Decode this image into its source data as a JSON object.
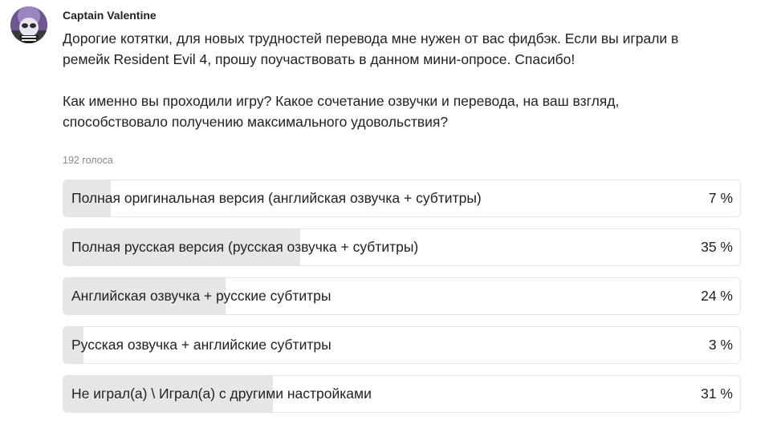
{
  "post": {
    "author": "Captain Valentine",
    "avatar_icon": "avatar-image",
    "paragraphs": [
      "Дорогие котятки, для новых трудностей перевода мне нужен от вас фидбэк. Если вы играли в\nремейк Resident Evil 4, прошу поучаствовать в данном мини-опросе. Спасибо!",
      "Как именно вы проходили игру? Какое сочетание озвучки и перевода, на ваш взгляд,\nспособствовало получению максимального удовольствия?"
    ]
  },
  "poll": {
    "votes_label": "192 голоса",
    "fill_color": "#e6e6e6",
    "options": [
      {
        "label": "Полная оригинальная версия (английская озвучка + субтитры)",
        "percent_label": "7 %",
        "fill_fraction": 0.07
      },
      {
        "label": "Полная русская версия (русская озвучка + субтитры)",
        "percent_label": "35 %",
        "fill_fraction": 0.35
      },
      {
        "label": "Английская озвучка + русские субтитры",
        "percent_label": "24 %",
        "fill_fraction": 0.24
      },
      {
        "label": "Русская озвучка + английские субтитры",
        "percent_label": "3 %",
        "fill_fraction": 0.03
      },
      {
        "label": "Не играл(а) \\ Играл(а) с другими настройками",
        "percent_label": "31 %",
        "fill_fraction": 0.31
      }
    ]
  }
}
